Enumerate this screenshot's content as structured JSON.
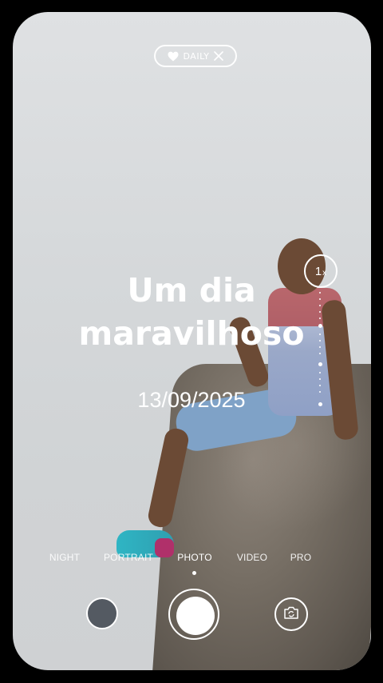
{
  "badge": {
    "icon": "heart-icon",
    "label": "DAILY",
    "close_icon": "close-icon"
  },
  "overlay": {
    "title_line1": "Um dia",
    "title_line2": "maravilhoso",
    "date": "13/09/2025"
  },
  "zoom": {
    "value": "1",
    "unit": "x"
  },
  "modes": [
    {
      "label": "NIGHT"
    },
    {
      "label": "PORTRAIT"
    },
    {
      "label": "PHOTO",
      "active": true
    },
    {
      "label": "VIDEO"
    },
    {
      "label": "PRO"
    }
  ],
  "controls": {
    "gallery": "gallery-thumbnail",
    "shutter": "shutter-button",
    "flip": "camera-flip-icon"
  }
}
